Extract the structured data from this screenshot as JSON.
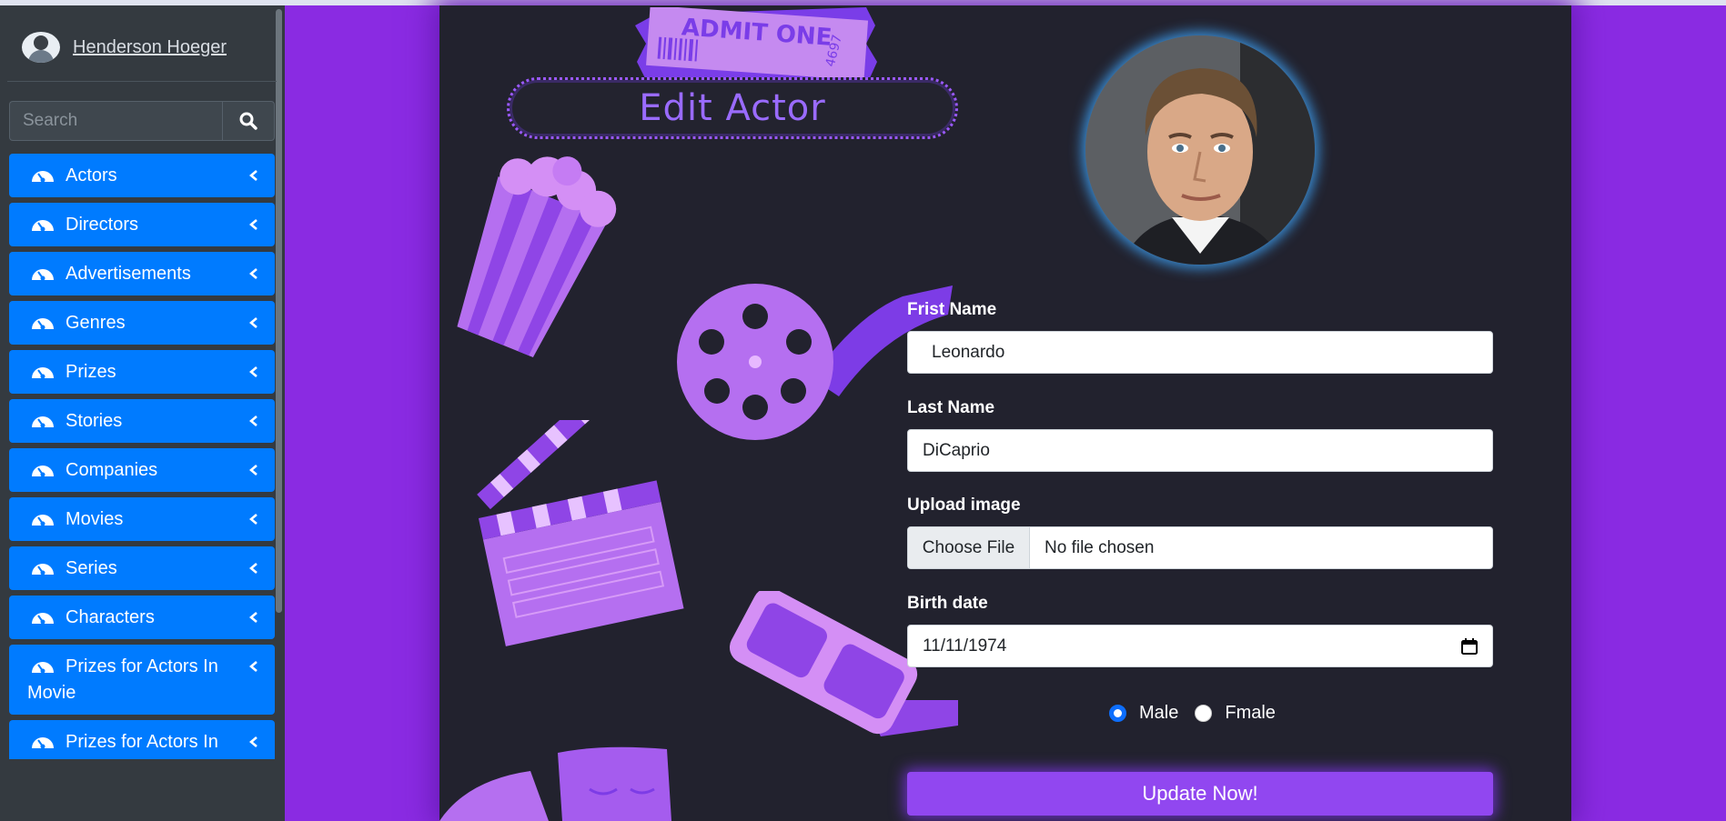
{
  "user": {
    "name": "Henderson Hoeger"
  },
  "search": {
    "placeholder": "Search"
  },
  "sidebar": {
    "items": [
      {
        "label": "Actors"
      },
      {
        "label": "Directors"
      },
      {
        "label": "Advertisements"
      },
      {
        "label": "Genres"
      },
      {
        "label": "Prizes"
      },
      {
        "label": "Stories"
      },
      {
        "label": "Companies"
      },
      {
        "label": "Movies"
      },
      {
        "label": "Series"
      },
      {
        "label": "Characters"
      },
      {
        "label": "Prizes for Actors In Movie"
      },
      {
        "label": "Prizes for Actors In"
      }
    ]
  },
  "page": {
    "title": "Edit Actor",
    "ticket_text": "ADMIT ONE",
    "ticket_number": "4697"
  },
  "form": {
    "first_name_label": "Frist Name",
    "first_name_value": "Leonardo",
    "last_name_label": "Last Name",
    "last_name_value": "DiCaprio",
    "upload_label": "Upload image",
    "file_button": "Choose File",
    "file_status": "No file chosen",
    "birth_label": "Birth date",
    "birth_value": "11/11/1974",
    "gender_male": "Male",
    "gender_female": "Fmale",
    "gender_selected": "Male",
    "submit_label": "Update Now!"
  },
  "colors": {
    "page_bg": "#8a2be2",
    "panel_bg": "#22222e",
    "nav_item_bg": "#007bff",
    "accent_purple": "#9147f0"
  }
}
